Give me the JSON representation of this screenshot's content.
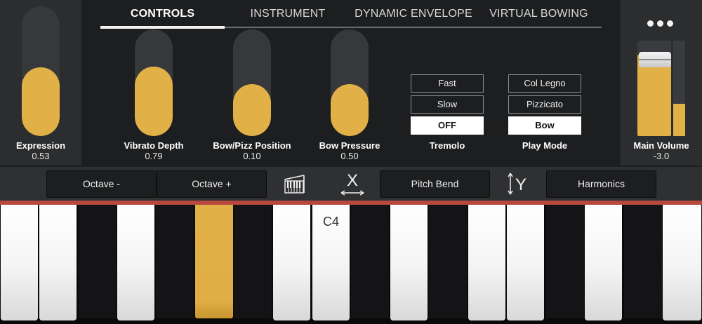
{
  "tabs": [
    {
      "label": "CONTROLS",
      "active": true
    },
    {
      "label": "INSTRUMENT",
      "active": false
    },
    {
      "label": "DYNAMIC ENVELOPE",
      "active": false
    },
    {
      "label": "VIRTUAL BOWING",
      "active": false
    }
  ],
  "sliders": {
    "expression": {
      "label": "Expression",
      "value": "0.53",
      "level": 0.53
    },
    "vibrato_depth": {
      "label": "Vibrato Depth",
      "value": "0.79",
      "level": 0.65
    },
    "bow_pizz_position": {
      "label": "Bow/Pizz Position",
      "value": "0.10",
      "level": 0.49
    },
    "bow_pressure": {
      "label": "Bow Pressure",
      "value": "0.50",
      "level": 0.49
    }
  },
  "tremolo": {
    "label": "Tremolo",
    "options": [
      "Fast",
      "Slow",
      "OFF"
    ],
    "selected": "OFF"
  },
  "play_mode": {
    "label": "Play Mode",
    "options": [
      "Col Legno",
      "Pizzicato",
      "Bow"
    ],
    "selected": "Bow"
  },
  "main_volume": {
    "label": "Main Volume",
    "value": "-3.0",
    "level": 0.85,
    "meter_level": 0.34
  },
  "toolbar": {
    "octave_down": "Octave -",
    "octave_up": "Octave +",
    "pitch_bend": "Pitch Bend",
    "harmonics": "Harmonics",
    "x_axis_label": "X",
    "y_axis_label": "Y"
  },
  "keyboard": {
    "label": "C4",
    "pressed_key": "G#"
  },
  "colors": {
    "accent": "#e1b046",
    "background": "#1d1e20",
    "panel": "#2c2d2f",
    "keyboard_strip": "#b8483d"
  },
  "icons": {
    "more": "more-horizontal-icon",
    "piano": "piano-keys-icon",
    "x_axis": "x-axis-swap-icon",
    "y_axis": "y-axis-swap-icon"
  }
}
